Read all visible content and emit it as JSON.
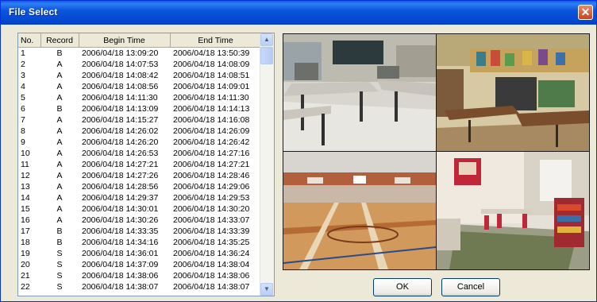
{
  "window": {
    "title": "File Select",
    "close_symbol": "✕",
    "colors": {
      "titlebar": "#0b56dc",
      "client": "#ece9d8",
      "close": "#d9572f"
    }
  },
  "file_list": {
    "columns": [
      "No.",
      "Record",
      "Begin Time",
      "End Time"
    ],
    "rows": [
      [
        "1",
        "B",
        "2006/04/18 13:09:20",
        "2006/04/18 13:50:39"
      ],
      [
        "2",
        "A",
        "2006/04/18 14:07:53",
        "2006/04/18 14:08:09"
      ],
      [
        "3",
        "A",
        "2006/04/18 14:08:42",
        "2006/04/18 14:08:51"
      ],
      [
        "4",
        "A",
        "2006/04/18 14:08:56",
        "2006/04/18 14:09:01"
      ],
      [
        "5",
        "A",
        "2006/04/18 14:11:30",
        "2006/04/18 14:11:30"
      ],
      [
        "6",
        "B",
        "2006/04/18 14:13:09",
        "2006/04/18 14:14:13"
      ],
      [
        "7",
        "A",
        "2006/04/18 14:15:27",
        "2006/04/18 14:16:08"
      ],
      [
        "8",
        "A",
        "2006/04/18 14:26:02",
        "2006/04/18 14:26:09"
      ],
      [
        "9",
        "A",
        "2006/04/18 14:26:20",
        "2006/04/18 14:26:42"
      ],
      [
        "10",
        "A",
        "2006/04/18 14:26:53",
        "2006/04/18 14:27:16"
      ],
      [
        "11",
        "A",
        "2006/04/18 14:27:21",
        "2006/04/18 14:27:21"
      ],
      [
        "12",
        "A",
        "2006/04/18 14:27:26",
        "2006/04/18 14:28:46"
      ],
      [
        "13",
        "A",
        "2006/04/18 14:28:56",
        "2006/04/18 14:29:06"
      ],
      [
        "14",
        "A",
        "2006/04/18 14:29:37",
        "2006/04/18 14:29:53"
      ],
      [
        "15",
        "A",
        "2006/04/18 14:30:01",
        "2006/04/18 14:30:20"
      ],
      [
        "16",
        "A",
        "2006/04/18 14:30:26",
        "2006/04/18 14:33:07"
      ],
      [
        "17",
        "B",
        "2006/04/18 14:33:35",
        "2006/04/18 14:33:39"
      ],
      [
        "18",
        "B",
        "2006/04/18 14:34:16",
        "2006/04/18 14:35:25"
      ],
      [
        "19",
        "S",
        "2006/04/18 14:36:01",
        "2006/04/18 14:36:24"
      ],
      [
        "20",
        "S",
        "2006/04/18 14:37:09",
        "2006/04/18 14:38:04"
      ],
      [
        "21",
        "S",
        "2006/04/18 14:38:06",
        "2006/04/18 14:38:06"
      ],
      [
        "22",
        "S",
        "2006/04/18 14:38:07",
        "2006/04/18 14:38:07"
      ]
    ],
    "scroll_up_symbol": "▲",
    "scroll_down_symbol": "▼"
  },
  "preview": {
    "cameras": [
      "classroom-tables",
      "art-classroom",
      "gymnasium",
      "playroom"
    ]
  },
  "buttons": {
    "ok": "OK",
    "cancel": "Cancel"
  }
}
